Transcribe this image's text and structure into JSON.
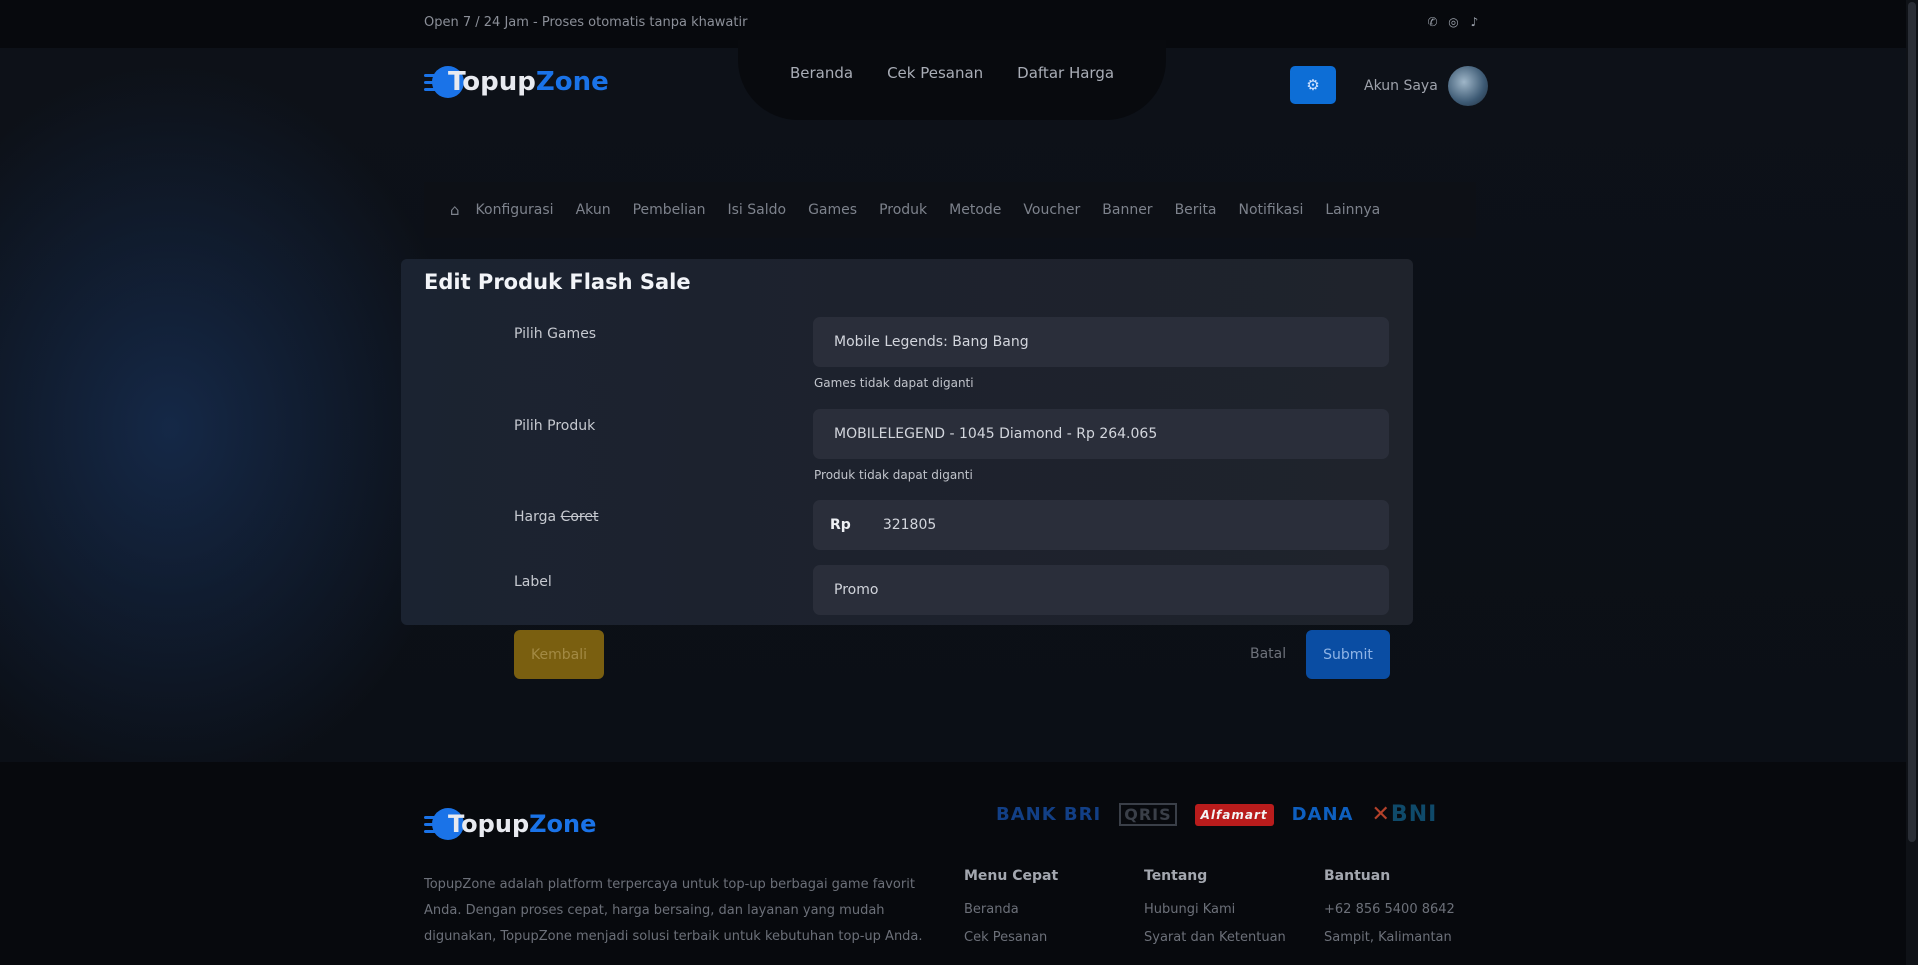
{
  "topbar": {
    "promo": "Open 7 / 24 Jam - Proses otomatis tanpa khawatir",
    "social": [
      "whatsapp-icon",
      "instagram-icon",
      "tiktok-icon"
    ]
  },
  "brand": {
    "part1": "Topup",
    "part2": "Zone",
    "accent": "#1a73e8"
  },
  "nav": {
    "items": [
      "Beranda",
      "Cek Pesanan",
      "Daftar Harga"
    ]
  },
  "account": {
    "label": "Akun Saya"
  },
  "admin_menu": {
    "items": [
      "Konfigurasi",
      "Akun",
      "Pembelian",
      "Isi Saldo",
      "Games",
      "Produk",
      "Metode",
      "Voucher",
      "Banner",
      "Berita",
      "Notifikasi",
      "Lainnya"
    ]
  },
  "form": {
    "title": "Edit Produk Flash Sale",
    "games": {
      "label": "Pilih Games",
      "value": "Mobile Legends: Bang Bang",
      "hint": "Games tidak dapat diganti"
    },
    "product": {
      "label": "Pilih Produk",
      "value": "MOBILELEGEND - 1045 Diamond - Rp 264.065",
      "hint": "Produk tidak dapat diganti"
    },
    "strike_price": {
      "label": "Harga",
      "label_strike": "Coret",
      "prefix": "Rp",
      "value": "321805"
    },
    "tag": {
      "label": "Label",
      "value": "Promo"
    },
    "back_label": "Kembali",
    "cancel_label": "Batal",
    "submit_label": "Submit"
  },
  "footer": {
    "about": "TopupZone adalah platform terpercaya untuk top-up berbagai game favorit Anda. Dengan proses cepat, harga bersaing, dan layanan yang mudah digunakan, TopupZone menjadi solusi terbaik untuk kebutuhan top-up Anda.",
    "payments": {
      "bri": "BANK BRI",
      "qris": "QRIS",
      "alfamart": "Alfamart",
      "dana": "DANA",
      "bni": "BNI"
    },
    "columns": [
      {
        "title": "Menu Cepat",
        "links": [
          "Beranda",
          "Cek Pesanan"
        ]
      },
      {
        "title": "Tentang",
        "links": [
          "Hubungi Kami",
          "Syarat dan Ketentuan"
        ]
      },
      {
        "title": "Bantuan",
        "links": [
          "+62 856 5400 8642",
          "Sampit, Kalimantan"
        ]
      }
    ]
  }
}
